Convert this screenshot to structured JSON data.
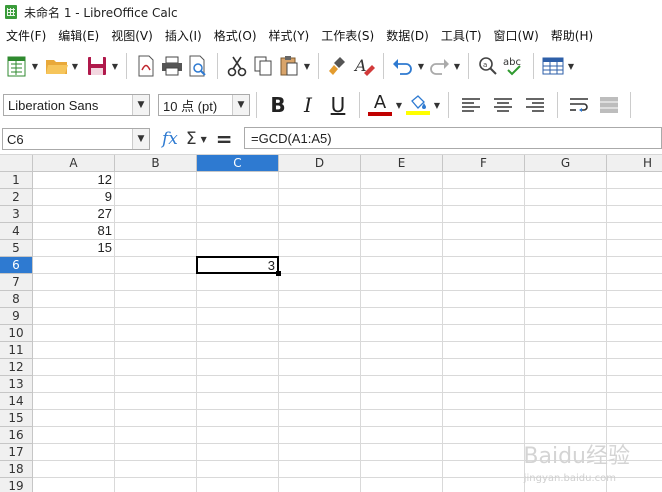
{
  "window": {
    "title": "未命名 1 - LibreOffice Calc"
  },
  "menu": [
    "文件(F)",
    "编辑(E)",
    "视图(V)",
    "插入(I)",
    "格式(O)",
    "样式(Y)",
    "工作表(S)",
    "数据(D)",
    "工具(T)",
    "窗口(W)",
    "帮助(H)"
  ],
  "toolbar": {
    "buttons": [
      "new-spreadsheet-icon",
      "open-folder-icon",
      "save-icon",
      "export-pdf-icon",
      "print-icon",
      "print-preview-icon",
      "cut-icon",
      "copy-icon",
      "paste-icon",
      "clone-formatting-icon",
      "clear-formatting-icon",
      "undo-icon",
      "redo-icon",
      "find-replace-icon",
      "spelling-icon",
      "grid-rows-icon"
    ]
  },
  "format": {
    "font_name": "Liberation Sans",
    "font_size": "10 点 (pt)",
    "bold": "B",
    "italic": "I",
    "underline": "U",
    "font_color_letter": "A"
  },
  "formula_bar": {
    "name_box": "C6",
    "fx": "fx",
    "sigma": "Σ",
    "equals": "=",
    "formula": "=GCD(A1:A5)"
  },
  "sheet": {
    "columns": [
      "A",
      "B",
      "C",
      "D",
      "E",
      "F",
      "G",
      "H"
    ],
    "active_column": "C",
    "rows": [
      "1",
      "2",
      "3",
      "4",
      "5",
      "6",
      "7",
      "8",
      "9",
      "10",
      "11",
      "12",
      "13",
      "14",
      "15",
      "16",
      "17",
      "18",
      "19"
    ],
    "active_row": "6",
    "values": {
      "A1": "12",
      "A2": "9",
      "A3": "27",
      "A4": "81",
      "A5": "15",
      "C6": "3"
    }
  },
  "watermark": {
    "text": "Baidu经验",
    "url": "jingyan.baidu.com"
  },
  "colors": {
    "accent": "#2e7ad1",
    "font_color_bar": "#c00000",
    "highlight_bar": "#ffff00"
  }
}
